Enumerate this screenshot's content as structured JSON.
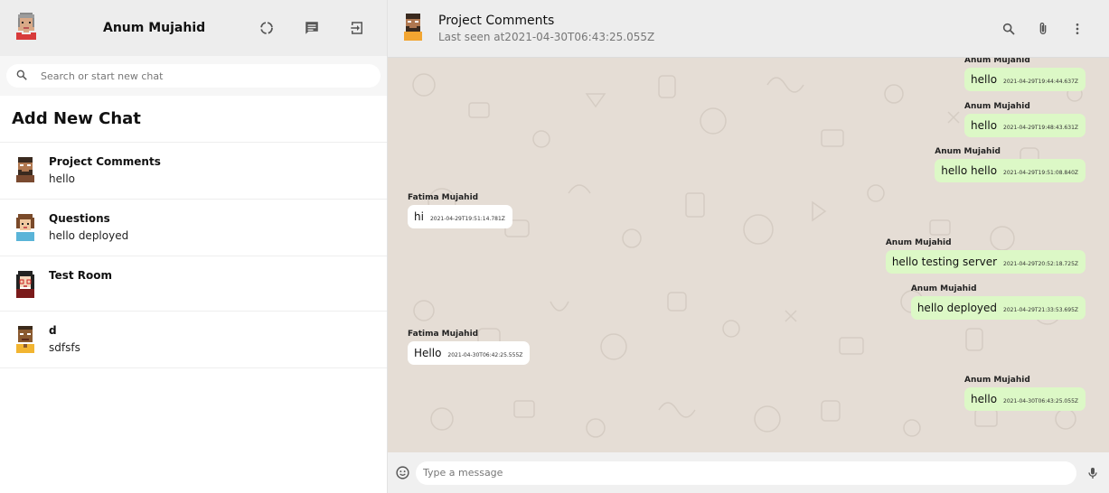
{
  "sidebar": {
    "user_name": "Anum Mujahid",
    "search_placeholder": "Search or start new chat",
    "add_chat_label": "Add New Chat",
    "chats": [
      {
        "title": "Project Comments",
        "last_message": "hello",
        "avatar": "avatar-bearded-man"
      },
      {
        "title": "Questions",
        "last_message": "hello deployed",
        "avatar": "avatar-woman-blue"
      },
      {
        "title": "Test Room",
        "last_message": "",
        "avatar": "avatar-woman-glasses"
      },
      {
        "title": "d",
        "last_message": "sdfsfs",
        "avatar": "avatar-man-dark"
      }
    ],
    "icons": [
      "status-icon",
      "new-chat-icon",
      "logout-icon"
    ]
  },
  "chat": {
    "title": "Project Comments",
    "last_seen": "Last seen at2021-04-30T06:43:25.055Z",
    "header_icons": [
      "search-icon",
      "attach-icon",
      "more-icon"
    ],
    "messages": [
      {
        "sender": "Anum Mujahid",
        "text": "hello",
        "time": "2021-04-29T19:44:44.637Z",
        "outgoing": true
      },
      {
        "sender": "Anum Mujahid",
        "text": "hello",
        "time": "2021-04-29T19:48:43.631Z",
        "outgoing": true
      },
      {
        "sender": "Anum Mujahid",
        "text": "hello hello",
        "time": "2021-04-29T19:51:08.840Z",
        "outgoing": true
      },
      {
        "sender": "Fatima Mujahid",
        "text": "hi",
        "time": "2021-04-29T19:51:14.781Z",
        "outgoing": false
      },
      {
        "sender": "Anum Mujahid",
        "text": "hello testing server",
        "time": "2021-04-29T20:52:18.725Z",
        "outgoing": true
      },
      {
        "sender": "Anum Mujahid",
        "text": "hello deployed",
        "time": "2021-04-29T21:33:53.695Z",
        "outgoing": true
      },
      {
        "sender": "Fatima Mujahid",
        "text": "Hello",
        "time": "2021-04-30T06:42:25.555Z",
        "outgoing": false
      },
      {
        "sender": "Anum Mujahid",
        "text": "hello",
        "time": "2021-04-30T06:43:25.055Z",
        "outgoing": true
      }
    ],
    "footer": {
      "placeholder": "Type a message"
    }
  },
  "colors": {
    "header_bg": "#ededed",
    "chat_bg": "#e5ddd5",
    "outgoing_bubble": "#dcf8c6",
    "incoming_bubble": "#ffffff"
  }
}
